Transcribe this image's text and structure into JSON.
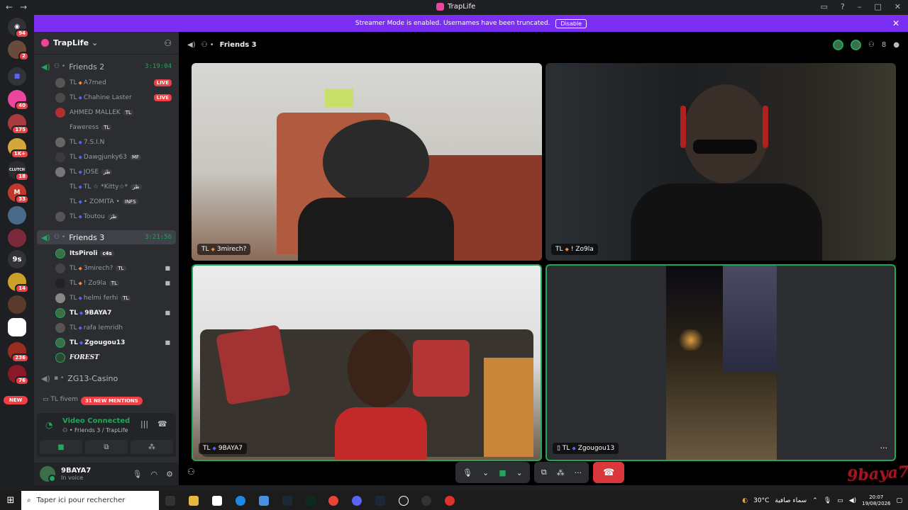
{
  "window": {
    "title": "TrapLife"
  },
  "banner": {
    "text": "Streamer Mode is enabled. Usernames have been truncated.",
    "disable_label": "Disable"
  },
  "rail": {
    "badges": [
      "94",
      "2",
      "40",
      "175",
      "1K+",
      "18",
      "33",
      "14",
      "236",
      "76"
    ],
    "labels": {
      "clutch": "CLUTCH",
      "nine_s": "9s"
    },
    "new_label": "NEW"
  },
  "server": {
    "name": "TrapLife"
  },
  "voice_channels": {
    "friends2": {
      "name": "Friends 2",
      "timer": "3:19:04"
    },
    "friends3": {
      "name": "Friends 3",
      "timer": "3:21:56"
    },
    "zg13": {
      "name": "ZG13-Casino"
    }
  },
  "friends2_members": [
    {
      "prefix": "TL",
      "name": "A7med",
      "live": "LIVE"
    },
    {
      "prefix": "TL",
      "name": "Chahine Laster",
      "live": "LIVE"
    },
    {
      "prefix": "",
      "name": "AHMED MALLEK",
      "tag": "TL"
    },
    {
      "prefix": "",
      "name": "Faweress",
      "tag": "TL"
    },
    {
      "prefix": "TL",
      "name": "7.S.I.N"
    },
    {
      "prefix": "TL",
      "name": "Dawgjunky63",
      "tag": "MF"
    },
    {
      "prefix": "TL",
      "name": "JOSE",
      "tag": "ظز"
    },
    {
      "prefix": "TL",
      "name": "TL ☆ *Kitty☆*",
      "tag": "ظز"
    },
    {
      "prefix": "TL",
      "name": "• ZOMITA •",
      "tag": "INFS"
    },
    {
      "prefix": "TL",
      "name": "Toutou",
      "tag": "ظز"
    }
  ],
  "friends3_members": [
    {
      "prefix": "",
      "name": "ItsPiroli",
      "tag": "c4s"
    },
    {
      "prefix": "TL",
      "name": "3mirech?",
      "tag": "TL"
    },
    {
      "prefix": "TL",
      "name": "! Zo9la",
      "tag": "TL"
    },
    {
      "prefix": "TL",
      "name": "helmi ferhi",
      "tag": "TL"
    },
    {
      "prefix": "TL",
      "name": "9BAYA7"
    },
    {
      "prefix": "TL",
      "name": "rafa lemridh"
    },
    {
      "prefix": "TL",
      "name": "Zgougou13"
    },
    {
      "prefix": "",
      "name": "FOREST"
    }
  ],
  "sidebar_extra": {
    "tlfivem": "TL fivem",
    "mentions": "31 NEW MENTIONS"
  },
  "voice_panel": {
    "status": "Video Connected",
    "location": "Friends 3 / TrapLife"
  },
  "user": {
    "name": "9BAYA7",
    "status": "In voice"
  },
  "call": {
    "channel": "Friends 3",
    "participant_count": "8",
    "tiles": [
      {
        "prefix": "TL",
        "name": "3mirech?"
      },
      {
        "prefix": "TL",
        "name": "! Zo9la"
      },
      {
        "prefix": "TL",
        "name": "9BAYA7"
      },
      {
        "prefix": "TL",
        "name": "Zgougou13"
      }
    ]
  },
  "watermark": "9baya7",
  "taskbar": {
    "search_placeholder": "Taper ici pour rechercher",
    "weather_temp": "30°C",
    "weather_text": "سماء صافية",
    "time": "20:07",
    "date": "19/08/2026"
  },
  "colors": {
    "accent_green": "#23a55a",
    "banner_purple": "#7b2ff2",
    "live_red": "#f23f43",
    "end_call": "#da373c"
  }
}
